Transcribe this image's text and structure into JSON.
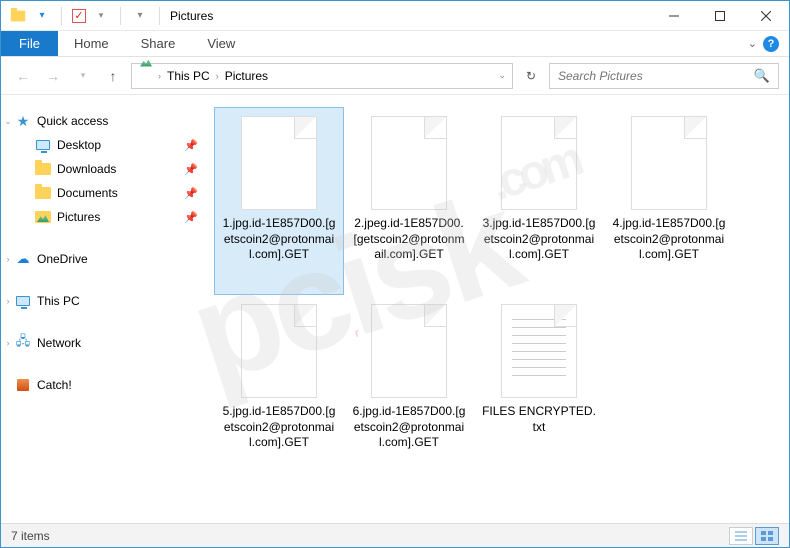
{
  "window": {
    "title": "Pictures"
  },
  "ribbon": {
    "file": "File",
    "tabs": [
      "Home",
      "Share",
      "View"
    ]
  },
  "breadcrumb": {
    "segments": [
      "This PC",
      "Pictures"
    ]
  },
  "search": {
    "placeholder": "Search Pictures"
  },
  "sidebar": {
    "quick": {
      "label": "Quick access",
      "items": [
        {
          "label": "Desktop",
          "icon": "desktop"
        },
        {
          "label": "Downloads",
          "icon": "folder"
        },
        {
          "label": "Documents",
          "icon": "folder"
        },
        {
          "label": "Pictures",
          "icon": "pic"
        }
      ]
    },
    "onedrive": {
      "label": "OneDrive"
    },
    "thispc": {
      "label": "This PC"
    },
    "network": {
      "label": "Network"
    },
    "catch": {
      "label": "Catch!"
    }
  },
  "files": [
    {
      "name": "1.jpg.id-1E857D00.[getscoin2@protonmail.com].GET",
      "type": "file",
      "selected": true
    },
    {
      "name": "2.jpeg.id-1E857D00.[getscoin2@protonmail.com].GET",
      "type": "file",
      "selected": false
    },
    {
      "name": "3.jpg.id-1E857D00.[getscoin2@protonmail.com].GET",
      "type": "file",
      "selected": false
    },
    {
      "name": "4.jpg.id-1E857D00.[getscoin2@protonmail.com].GET",
      "type": "file",
      "selected": false
    },
    {
      "name": "5.jpg.id-1E857D00.[getscoin2@protonmail.com].GET",
      "type": "file",
      "selected": false
    },
    {
      "name": "6.jpg.id-1E857D00.[getscoin2@protonmail.com].GET",
      "type": "file",
      "selected": false
    },
    {
      "name": "FILES ENCRYPTED.txt",
      "type": "txt",
      "selected": false
    }
  ],
  "status": {
    "count": "7 items"
  }
}
